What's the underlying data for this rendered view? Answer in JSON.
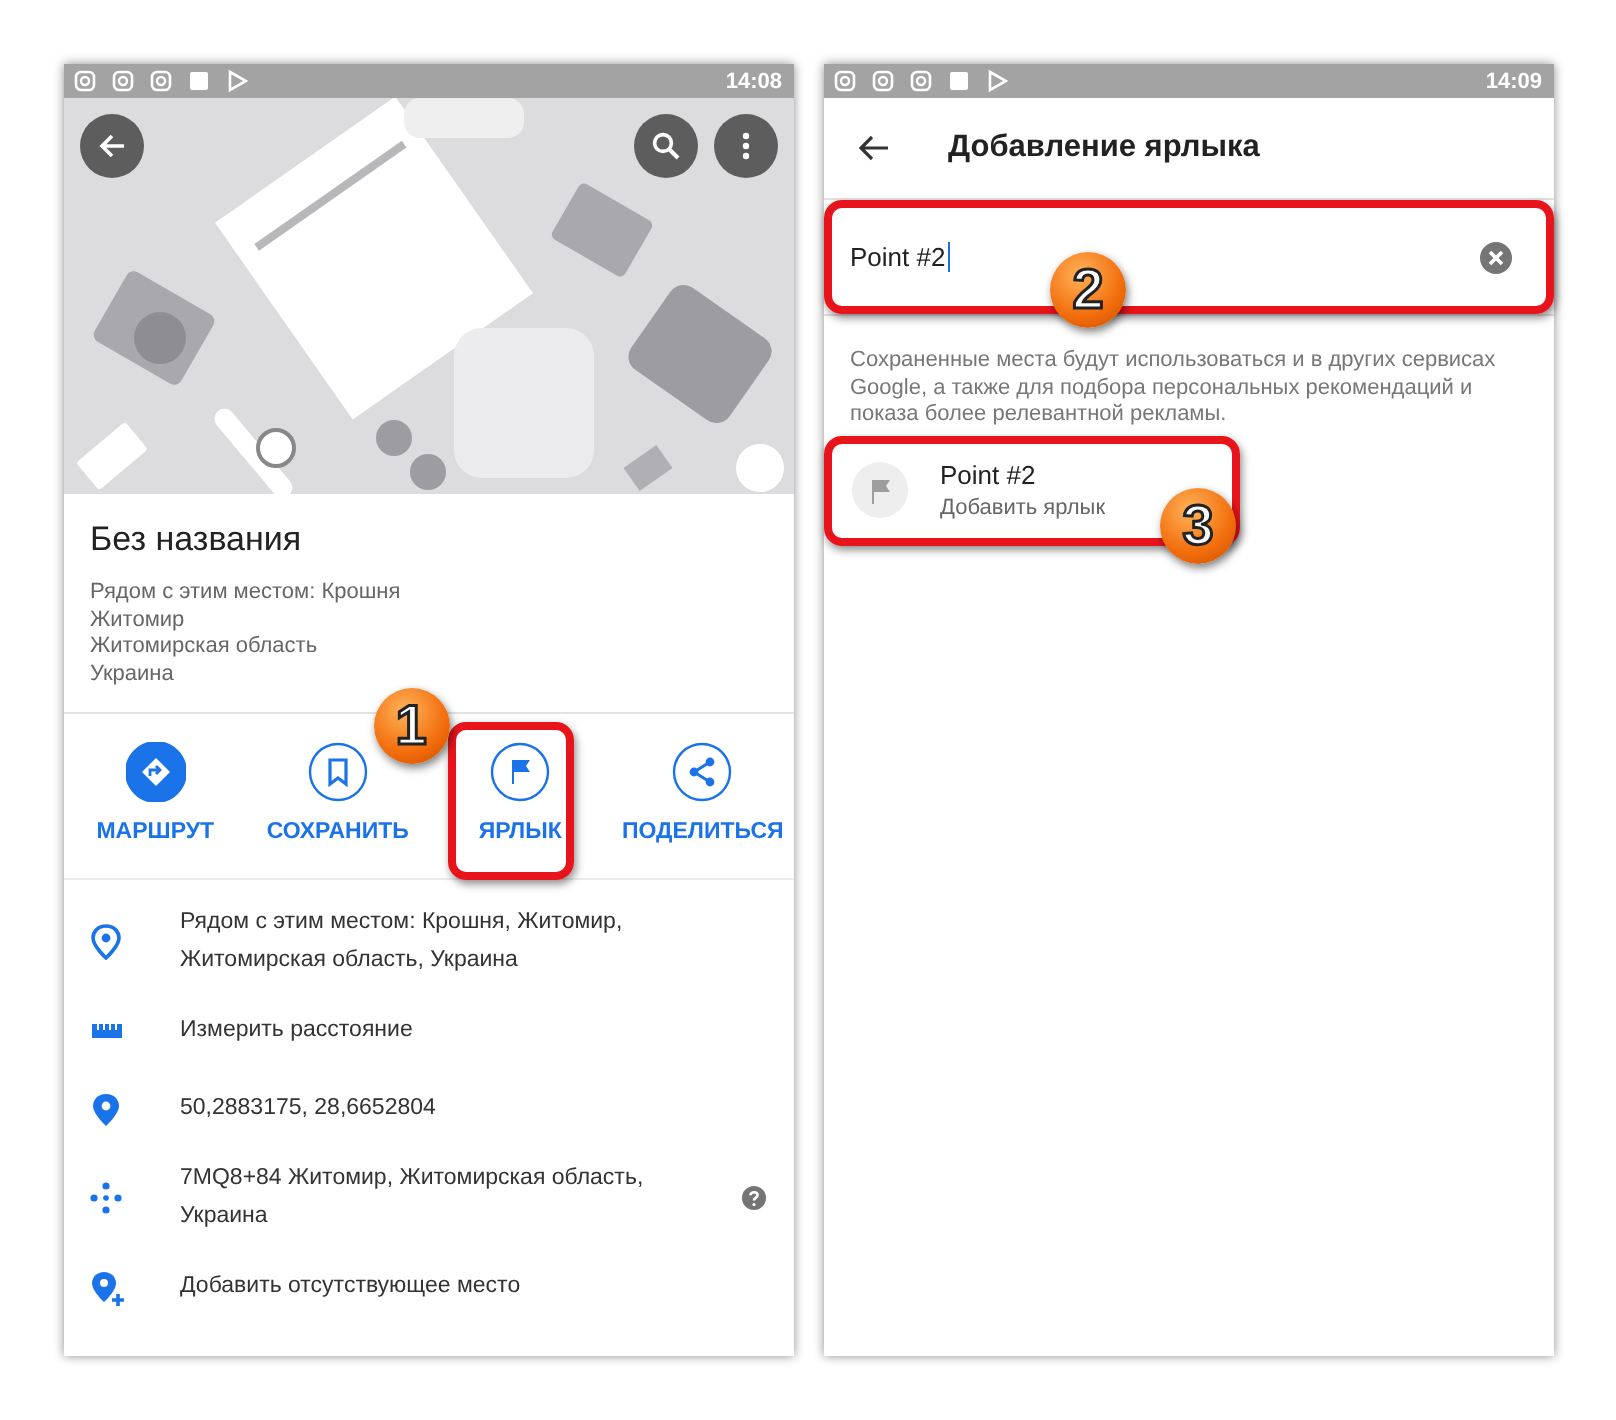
{
  "left_screen": {
    "status_bar": {
      "time": "14:08"
    },
    "place": {
      "title": "Без названия",
      "address_lines": [
        "Рядом с этим местом: Крошня",
        "Житомир",
        "Житомирская область",
        "Украина"
      ]
    },
    "actions": [
      {
        "kind": "route",
        "label": "МАРШРУТ",
        "primary": true
      },
      {
        "kind": "save",
        "label": "СОХРАНИТЬ",
        "primary": false
      },
      {
        "kind": "label",
        "label": "ЯРЛЫК",
        "primary": false,
        "callout": "1"
      },
      {
        "kind": "share",
        "label": "ПОДЕЛИТЬСЯ",
        "primary": false
      }
    ],
    "details": [
      {
        "kind": "pin-outline",
        "text": "Рядом с этим местом: Крошня, Житомир, Житомирская область, Украина",
        "help": false
      },
      {
        "kind": "ruler",
        "text": "Измерить расстояние",
        "help": false
      },
      {
        "kind": "pin",
        "text": "50,2883175, 28,6652804",
        "help": false
      },
      {
        "kind": "plus-code",
        "text": "7MQ8+84 Житомир, Житомирская область, Украина",
        "help": true
      },
      {
        "kind": "add-place",
        "text": "Добавить отсутствующее место",
        "help": false
      }
    ]
  },
  "right_screen": {
    "status_bar": {
      "time": "14:09"
    },
    "title": "Добавление ярлыка",
    "field": {
      "value": "Point #2",
      "callout": "2"
    },
    "note": "Сохраненные места будут использоваться и в других сервисах Google, а также для подбора персональных рекомендаций и показа более релевантной рекламы.",
    "suggestion": {
      "title": "Point #2",
      "subtitle": "Добавить ярлык",
      "callout": "3"
    }
  }
}
